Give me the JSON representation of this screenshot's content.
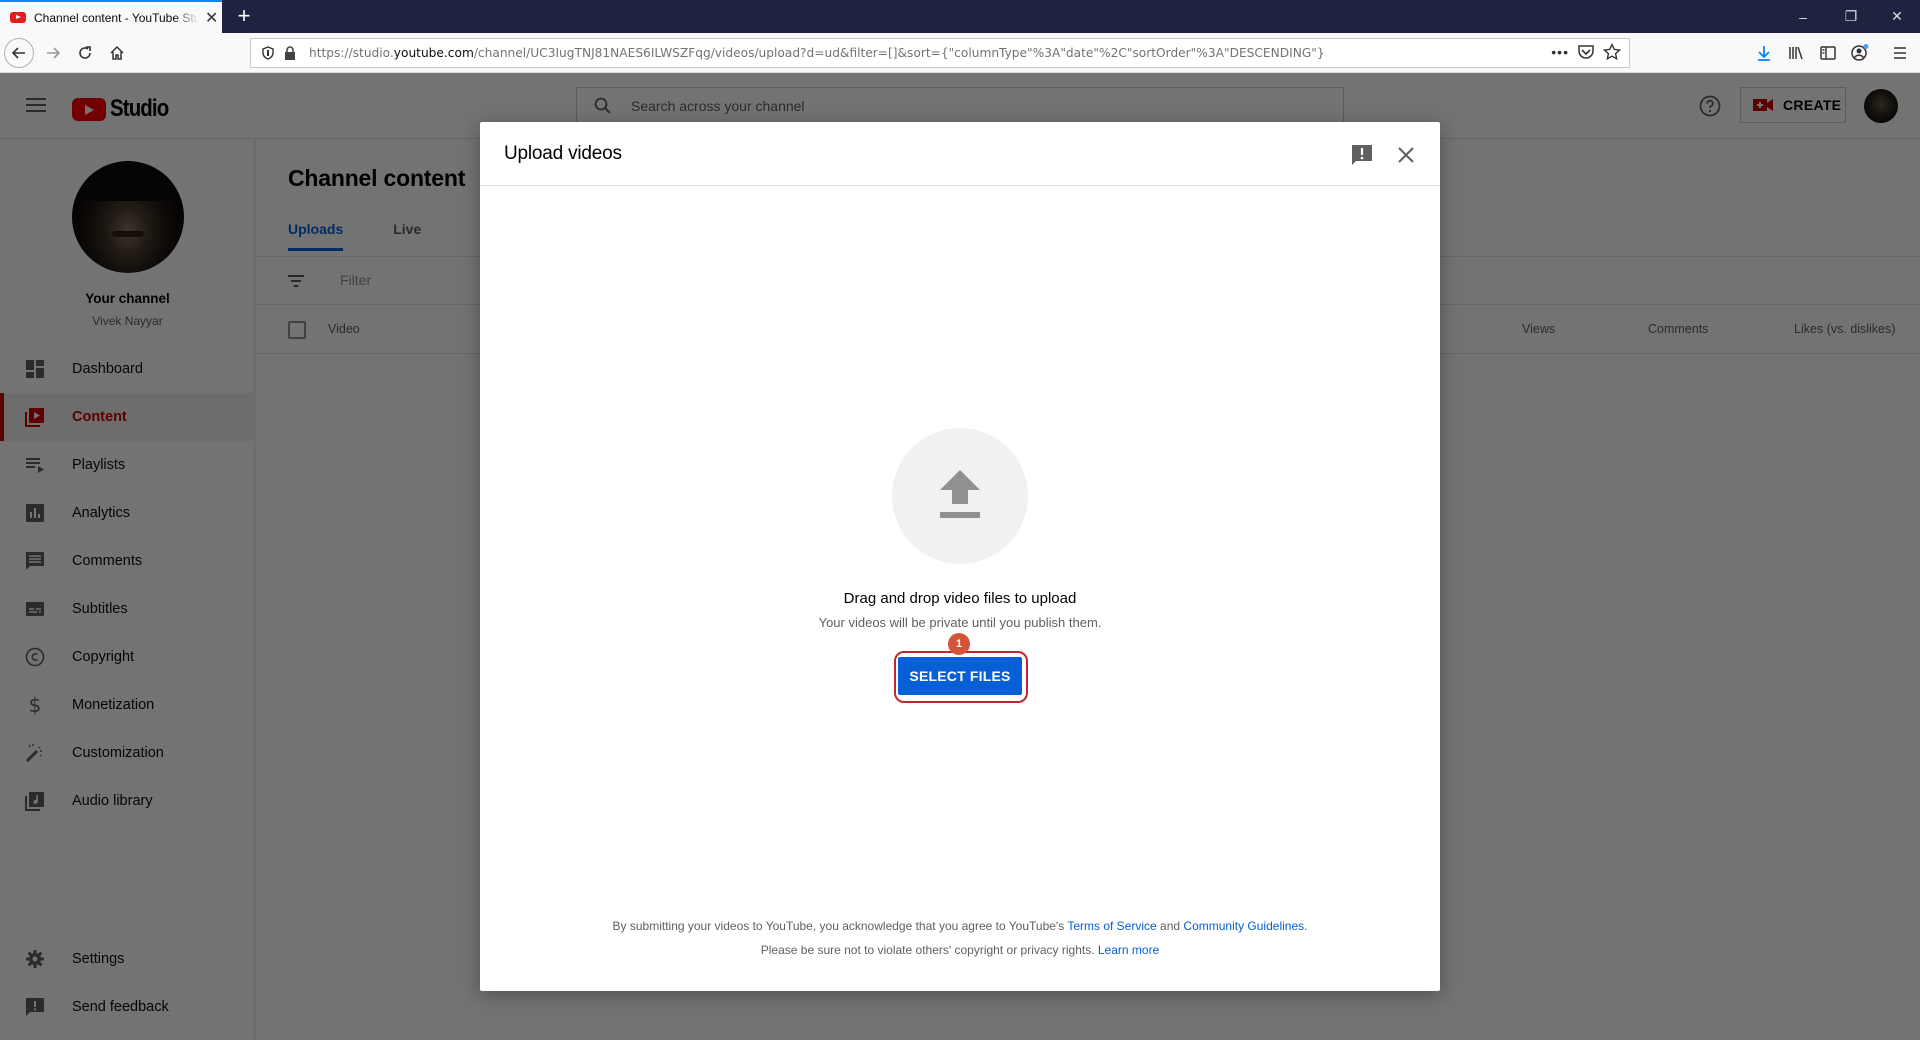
{
  "browser": {
    "tab_title": "Channel content - YouTube Studio",
    "new_tab_label": "+",
    "url_prefix": "https://studio.",
    "url_domain": "youtube.com",
    "url_rest": "/channel/UC3IugTNJ81NAES6ILWSZFqg/videos/upload?d=ud&filter=[]&sort={\"columnType\"%3A\"date\"%2C\"sortOrder\"%3A\"DESCENDING\"}",
    "page_actions_label": "•••",
    "icons": [
      "back-icon",
      "forward-icon",
      "reload-icon",
      "home-icon",
      "shield-icon",
      "lock-icon",
      "pocket-icon",
      "star-icon",
      "download-icon",
      "library-icon",
      "sidebar-icon",
      "account-icon",
      "menu-icon"
    ]
  },
  "window_controls": {
    "minimize": "–",
    "restore": "❐",
    "close": "✕"
  },
  "header": {
    "logo_text": "Studio",
    "search_placeholder": "Search across your channel",
    "create_label": "CREATE",
    "help_icon": "help-icon"
  },
  "sidebar": {
    "channel_title": "Your channel",
    "channel_name": "Vivek Nayyar",
    "items": [
      {
        "label": "Dashboard",
        "icon": "dashboard-icon",
        "active": false
      },
      {
        "label": "Content",
        "icon": "content-icon",
        "active": true
      },
      {
        "label": "Playlists",
        "icon": "playlists-icon",
        "active": false
      },
      {
        "label": "Analytics",
        "icon": "analytics-icon",
        "active": false
      },
      {
        "label": "Comments",
        "icon": "comments-icon",
        "active": false
      },
      {
        "label": "Subtitles",
        "icon": "subtitles-icon",
        "active": false
      },
      {
        "label": "Copyright",
        "icon": "copyright-icon",
        "active": false
      },
      {
        "label": "Monetization",
        "icon": "monetization-icon",
        "active": false
      },
      {
        "label": "Customization",
        "icon": "customization-icon",
        "active": false
      },
      {
        "label": "Audio library",
        "icon": "audio-library-icon",
        "active": false
      }
    ],
    "bottom_items": [
      {
        "label": "Settings",
        "icon": "settings-icon"
      },
      {
        "label": "Send feedback",
        "icon": "feedback-icon"
      }
    ]
  },
  "main": {
    "page_title": "Channel content",
    "tabs": [
      {
        "label": "Uploads",
        "active": true
      },
      {
        "label": "Live",
        "active": false
      }
    ],
    "filter_placeholder": "Filter",
    "columns": [
      "Video",
      "Views",
      "Comments",
      "Likes (vs. dislikes)"
    ]
  },
  "modal": {
    "title": "Upload videos",
    "drag_text": "Drag and drop video files to upload",
    "private_text": "Your videos will be private until you publish them.",
    "select_button": "SELECT FILES",
    "step_badge": "1",
    "footer_line1_prefix": "By submitting your videos to YouTube, you acknowledge that you agree to YouTube's ",
    "terms_link": "Terms of Service",
    "footer_and": " and ",
    "guidelines_link": "Community Guidelines",
    "footer_period": ".",
    "footer_line2_prefix": "Please be sure not to violate others' copyright or privacy rights. ",
    "learn_more_link": "Learn more"
  },
  "colors": {
    "brand_red": "#ff0000",
    "active_red": "#cc0000",
    "link_blue": "#065fd4",
    "highlight_ring": "#c0272d",
    "badge_orange": "#d4543a",
    "browser_titlebar": "#1f2340"
  }
}
